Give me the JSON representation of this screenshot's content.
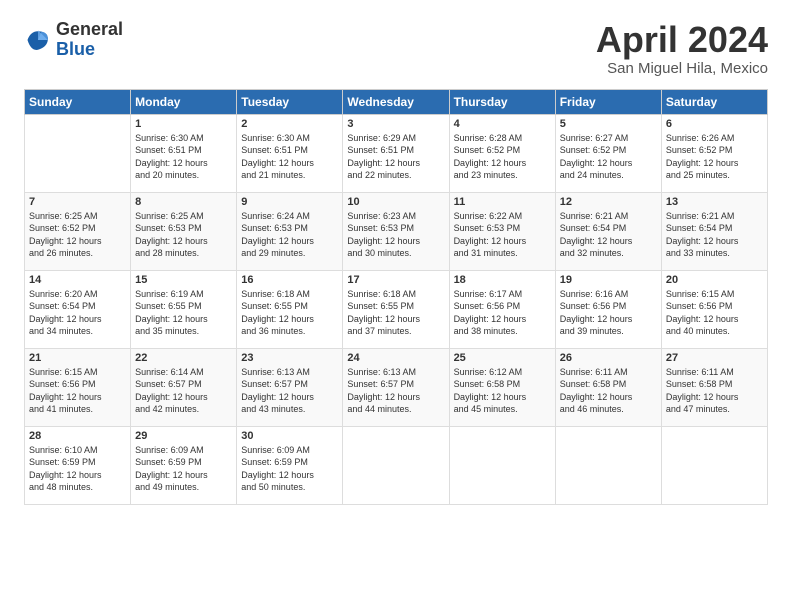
{
  "logo": {
    "general": "General",
    "blue": "Blue"
  },
  "title": "April 2024",
  "location": "San Miguel Hila, Mexico",
  "days_of_week": [
    "Sunday",
    "Monday",
    "Tuesday",
    "Wednesday",
    "Thursday",
    "Friday",
    "Saturday"
  ],
  "weeks": [
    [
      {
        "day": "",
        "info": ""
      },
      {
        "day": "1",
        "info": "Sunrise: 6:30 AM\nSunset: 6:51 PM\nDaylight: 12 hours\nand 20 minutes."
      },
      {
        "day": "2",
        "info": "Sunrise: 6:30 AM\nSunset: 6:51 PM\nDaylight: 12 hours\nand 21 minutes."
      },
      {
        "day": "3",
        "info": "Sunrise: 6:29 AM\nSunset: 6:51 PM\nDaylight: 12 hours\nand 22 minutes."
      },
      {
        "day": "4",
        "info": "Sunrise: 6:28 AM\nSunset: 6:52 PM\nDaylight: 12 hours\nand 23 minutes."
      },
      {
        "day": "5",
        "info": "Sunrise: 6:27 AM\nSunset: 6:52 PM\nDaylight: 12 hours\nand 24 minutes."
      },
      {
        "day": "6",
        "info": "Sunrise: 6:26 AM\nSunset: 6:52 PM\nDaylight: 12 hours\nand 25 minutes."
      }
    ],
    [
      {
        "day": "7",
        "info": "Sunrise: 6:25 AM\nSunset: 6:52 PM\nDaylight: 12 hours\nand 26 minutes."
      },
      {
        "day": "8",
        "info": "Sunrise: 6:25 AM\nSunset: 6:53 PM\nDaylight: 12 hours\nand 28 minutes."
      },
      {
        "day": "9",
        "info": "Sunrise: 6:24 AM\nSunset: 6:53 PM\nDaylight: 12 hours\nand 29 minutes."
      },
      {
        "day": "10",
        "info": "Sunrise: 6:23 AM\nSunset: 6:53 PM\nDaylight: 12 hours\nand 30 minutes."
      },
      {
        "day": "11",
        "info": "Sunrise: 6:22 AM\nSunset: 6:53 PM\nDaylight: 12 hours\nand 31 minutes."
      },
      {
        "day": "12",
        "info": "Sunrise: 6:21 AM\nSunset: 6:54 PM\nDaylight: 12 hours\nand 32 minutes."
      },
      {
        "day": "13",
        "info": "Sunrise: 6:21 AM\nSunset: 6:54 PM\nDaylight: 12 hours\nand 33 minutes."
      }
    ],
    [
      {
        "day": "14",
        "info": "Sunrise: 6:20 AM\nSunset: 6:54 PM\nDaylight: 12 hours\nand 34 minutes."
      },
      {
        "day": "15",
        "info": "Sunrise: 6:19 AM\nSunset: 6:55 PM\nDaylight: 12 hours\nand 35 minutes."
      },
      {
        "day": "16",
        "info": "Sunrise: 6:18 AM\nSunset: 6:55 PM\nDaylight: 12 hours\nand 36 minutes."
      },
      {
        "day": "17",
        "info": "Sunrise: 6:18 AM\nSunset: 6:55 PM\nDaylight: 12 hours\nand 37 minutes."
      },
      {
        "day": "18",
        "info": "Sunrise: 6:17 AM\nSunset: 6:56 PM\nDaylight: 12 hours\nand 38 minutes."
      },
      {
        "day": "19",
        "info": "Sunrise: 6:16 AM\nSunset: 6:56 PM\nDaylight: 12 hours\nand 39 minutes."
      },
      {
        "day": "20",
        "info": "Sunrise: 6:15 AM\nSunset: 6:56 PM\nDaylight: 12 hours\nand 40 minutes."
      }
    ],
    [
      {
        "day": "21",
        "info": "Sunrise: 6:15 AM\nSunset: 6:56 PM\nDaylight: 12 hours\nand 41 minutes."
      },
      {
        "day": "22",
        "info": "Sunrise: 6:14 AM\nSunset: 6:57 PM\nDaylight: 12 hours\nand 42 minutes."
      },
      {
        "day": "23",
        "info": "Sunrise: 6:13 AM\nSunset: 6:57 PM\nDaylight: 12 hours\nand 43 minutes."
      },
      {
        "day": "24",
        "info": "Sunrise: 6:13 AM\nSunset: 6:57 PM\nDaylight: 12 hours\nand 44 minutes."
      },
      {
        "day": "25",
        "info": "Sunrise: 6:12 AM\nSunset: 6:58 PM\nDaylight: 12 hours\nand 45 minutes."
      },
      {
        "day": "26",
        "info": "Sunrise: 6:11 AM\nSunset: 6:58 PM\nDaylight: 12 hours\nand 46 minutes."
      },
      {
        "day": "27",
        "info": "Sunrise: 6:11 AM\nSunset: 6:58 PM\nDaylight: 12 hours\nand 47 minutes."
      }
    ],
    [
      {
        "day": "28",
        "info": "Sunrise: 6:10 AM\nSunset: 6:59 PM\nDaylight: 12 hours\nand 48 minutes."
      },
      {
        "day": "29",
        "info": "Sunrise: 6:09 AM\nSunset: 6:59 PM\nDaylight: 12 hours\nand 49 minutes."
      },
      {
        "day": "30",
        "info": "Sunrise: 6:09 AM\nSunset: 6:59 PM\nDaylight: 12 hours\nand 50 minutes."
      },
      {
        "day": "",
        "info": ""
      },
      {
        "day": "",
        "info": ""
      },
      {
        "day": "",
        "info": ""
      },
      {
        "day": "",
        "info": ""
      }
    ]
  ]
}
